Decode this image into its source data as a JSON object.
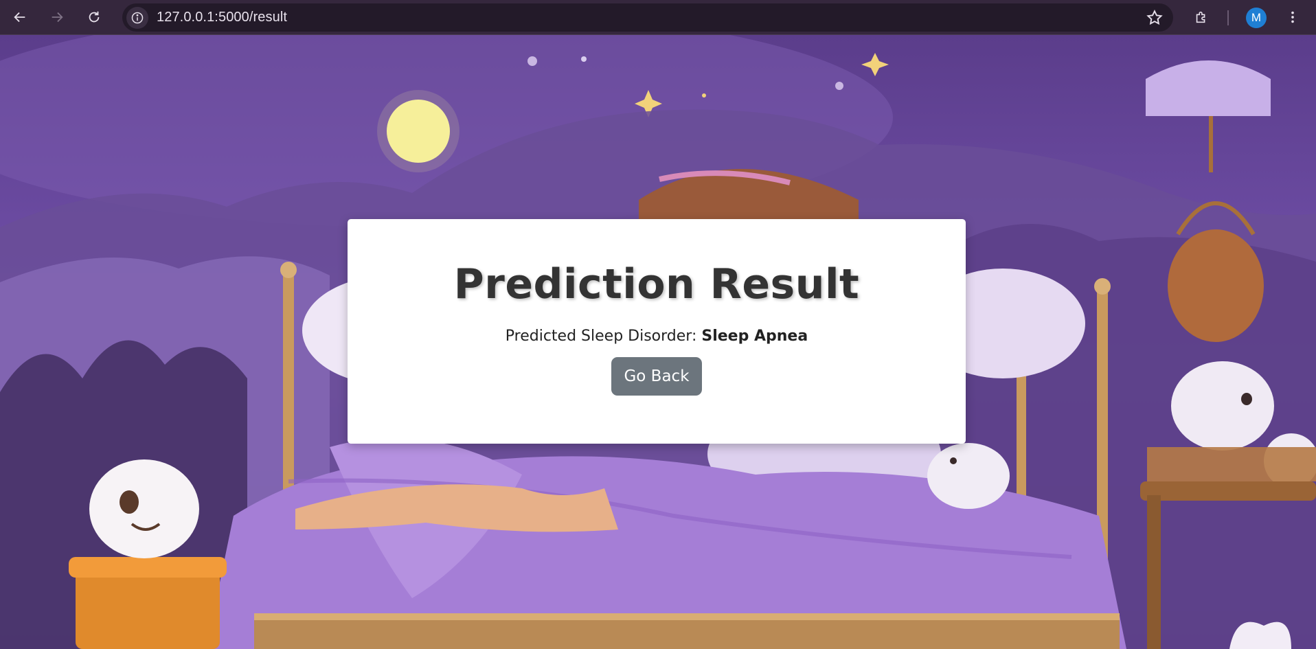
{
  "browser": {
    "url": "127.0.0.1:5000/result",
    "profile_initial": "M",
    "icons": {
      "back": "back-arrow-icon",
      "forward": "forward-arrow-icon",
      "reload": "reload-icon",
      "site_info": "info-icon",
      "bookmark": "star-icon",
      "extensions": "puzzle-icon",
      "menu": "kebab-menu-icon"
    }
  },
  "card": {
    "title": "Prediction Result",
    "result_label": "Predicted Sleep Disorder: ",
    "result_value": "Sleep Apnea",
    "button_label": "Go Back"
  },
  "colors": {
    "toolbar": "#35273d",
    "button": "#6c757d",
    "avatar": "#1f7fd4",
    "title": "#333333"
  }
}
